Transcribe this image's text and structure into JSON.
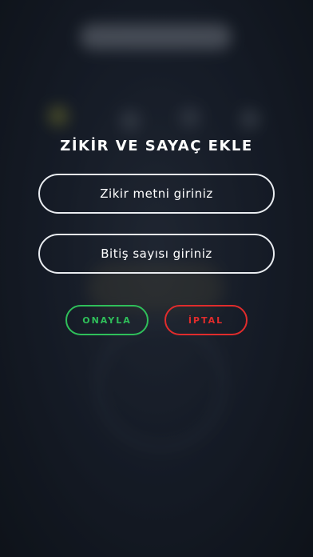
{
  "modal": {
    "title": "ZİKİR VE SAYAÇ EKLE",
    "zikir_placeholder": "Zikir metni giriniz",
    "bitis_placeholder": "Bitiş sayısı giriniz",
    "confirm_label": "ONAYLA",
    "cancel_label": "İPTAL"
  },
  "colors": {
    "confirm": "#2fbf5a",
    "cancel": "#e02c2c",
    "field_border": "#e9ecf0"
  }
}
